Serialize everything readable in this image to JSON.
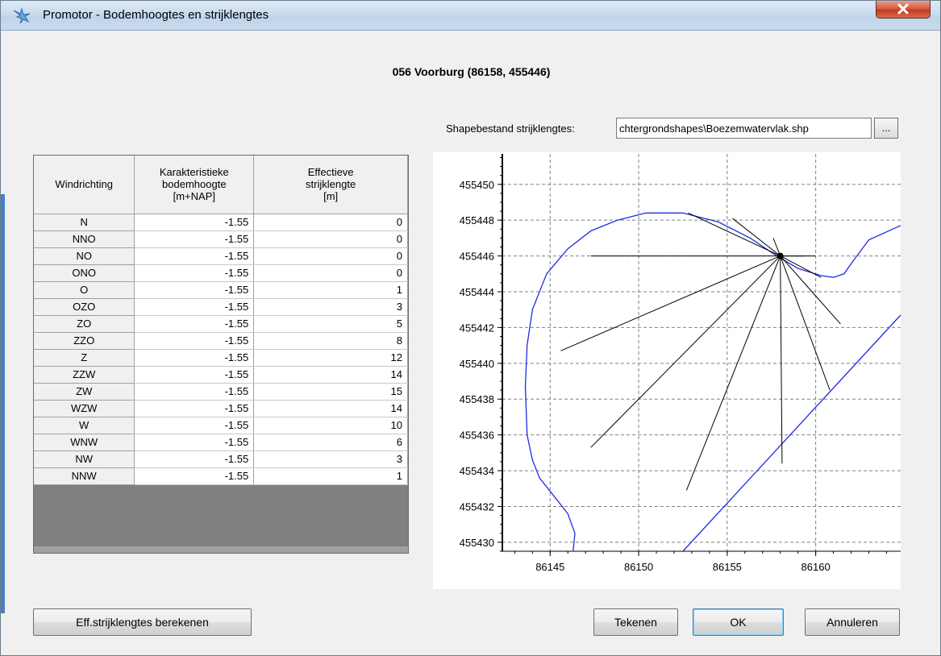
{
  "window": {
    "title": "Promotor - Bodemhoogtes en strijklengtes"
  },
  "location_title": "056 Voorburg (86158, 455446)",
  "shape": {
    "label": "Shapebestand strijklengtes:",
    "value": "chtergrondshapes\\Boezemwatervlak.shp",
    "browse_label": "..."
  },
  "table": {
    "headers": [
      "Windrichting",
      "Karakteristieke bodemhoogte [m+NAP]",
      "Effectieve strijklengte [m]"
    ],
    "header_lines": [
      [
        "Windrichting"
      ],
      [
        "Karakteristieke",
        "bodemhoogte",
        "[m+NAP]"
      ],
      [
        "Effectieve",
        "strijklengte",
        "[m]"
      ]
    ],
    "rows": [
      {
        "dir": "N",
        "height": "-1.55",
        "fetch": "0"
      },
      {
        "dir": "NNO",
        "height": "-1.55",
        "fetch": "0"
      },
      {
        "dir": "NO",
        "height": "-1.55",
        "fetch": "0"
      },
      {
        "dir": "ONO",
        "height": "-1.55",
        "fetch": "0"
      },
      {
        "dir": "O",
        "height": "-1.55",
        "fetch": "1"
      },
      {
        "dir": "OZO",
        "height": "-1.55",
        "fetch": "3"
      },
      {
        "dir": "ZO",
        "height": "-1.55",
        "fetch": "5"
      },
      {
        "dir": "ZZO",
        "height": "-1.55",
        "fetch": "8"
      },
      {
        "dir": "Z",
        "height": "-1.55",
        "fetch": "12"
      },
      {
        "dir": "ZZW",
        "height": "-1.55",
        "fetch": "14"
      },
      {
        "dir": "ZW",
        "height": "-1.55",
        "fetch": "15"
      },
      {
        "dir": "WZW",
        "height": "-1.55",
        "fetch": "14"
      },
      {
        "dir": "W",
        "height": "-1.55",
        "fetch": "10"
      },
      {
        "dir": "WNW",
        "height": "-1.55",
        "fetch": "6"
      },
      {
        "dir": "NW",
        "height": "-1.55",
        "fetch": "3"
      },
      {
        "dir": "NNW",
        "height": "-1.55",
        "fetch": "1"
      }
    ]
  },
  "chart_data": {
    "type": "line",
    "x_ticks": [
      86145,
      86150,
      86155,
      86160
    ],
    "y_ticks": [
      455430,
      455432,
      455434,
      455436,
      455438,
      455440,
      455442,
      455444,
      455446,
      455448,
      455450
    ],
    "xlim": [
      86142.3,
      86164.8
    ],
    "ylim": [
      455429.5,
      455451.7
    ],
    "grid": true,
    "origin": [
      86158,
      455446
    ],
    "fetch_ends": [
      [
        86152.8,
        455448.4
      ],
      [
        86155.3,
        455448.1
      ],
      [
        86157.6,
        455447.0
      ],
      [
        86159.3,
        455446.0
      ],
      [
        86160.3,
        455444.8
      ],
      [
        86161.4,
        455442.2
      ],
      [
        86160.8,
        455438.5
      ],
      [
        86158.1,
        455434.4
      ],
      [
        86152.7,
        455432.9
      ],
      [
        86147.3,
        455435.3
      ],
      [
        86145.6,
        455440.7
      ],
      [
        86147.3,
        455446.0
      ],
      [
        86160.0,
        455446.0
      ]
    ],
    "shore_curve": [
      [
        86146.3,
        455429.5
      ],
      [
        86146.4,
        455430.5
      ],
      [
        86146.0,
        455431.6
      ],
      [
        86145.2,
        455432.6
      ],
      [
        86144.4,
        455433.6
      ],
      [
        86144.0,
        455434.6
      ],
      [
        86143.7,
        455436.0
      ],
      [
        86143.6,
        455438.7
      ],
      [
        86143.7,
        455441.0
      ],
      [
        86144.0,
        455443.0
      ],
      [
        86144.8,
        455445.0
      ],
      [
        86146.0,
        455446.4
      ],
      [
        86147.3,
        455447.4
      ],
      [
        86148.8,
        455448.0
      ],
      [
        86150.4,
        455448.4
      ],
      [
        86152.5,
        455448.4
      ],
      [
        86154.5,
        455447.9
      ],
      [
        86156.3,
        455447.0
      ],
      [
        86157.8,
        455446.0
      ],
      [
        86159.0,
        455445.3
      ],
      [
        86160.3,
        455444.9
      ],
      [
        86161.0,
        455444.8
      ],
      [
        86161.6,
        455445.0
      ],
      [
        86162.1,
        455445.7
      ],
      [
        86163.0,
        455446.9
      ],
      [
        86164.8,
        455447.7
      ]
    ],
    "shore_line2": [
      [
        86152.5,
        455429.5
      ],
      [
        86164.8,
        455442.7
      ]
    ],
    "colors": {
      "shore": "#1b2ee0",
      "fetch": "#000000",
      "grid": "#808080"
    }
  },
  "buttons": {
    "calc": "Eff.strijklengtes berekenen",
    "draw": "Tekenen",
    "ok": "OK",
    "cancel": "Annuleren"
  }
}
